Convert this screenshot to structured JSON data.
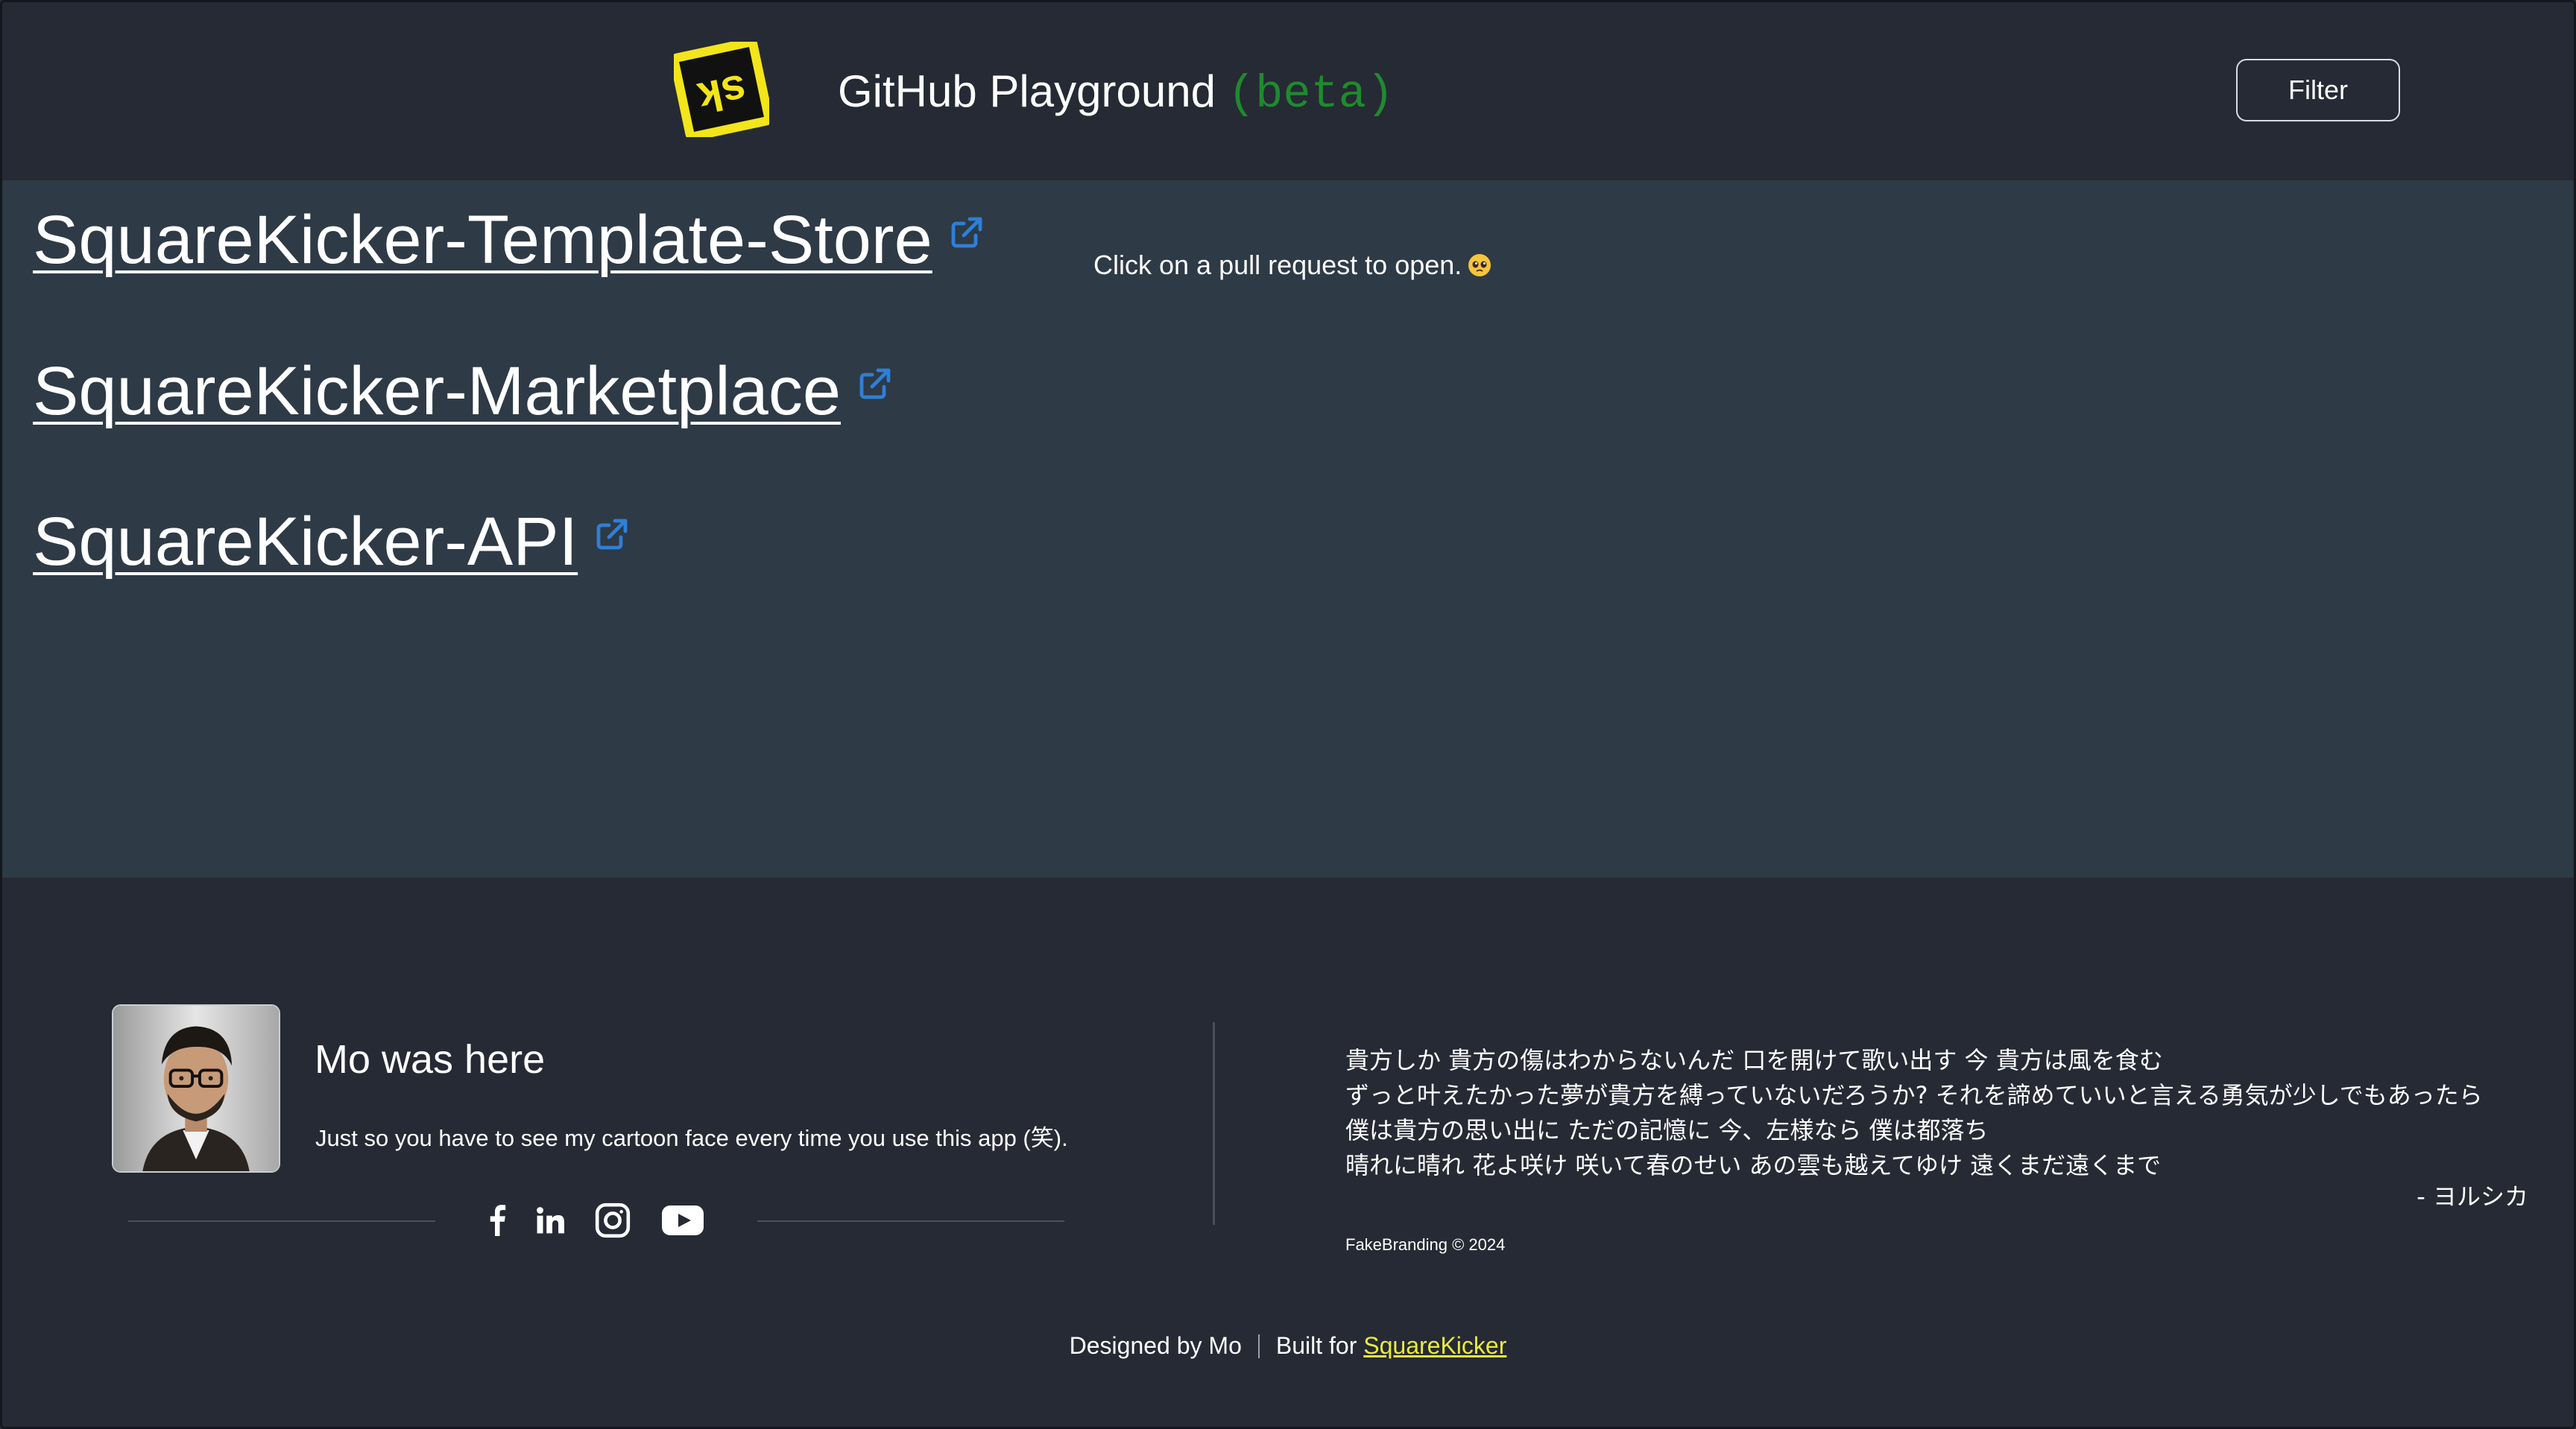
{
  "header": {
    "title": "GitHub Playground",
    "beta": "(beta)",
    "filter_label": "Filter",
    "logo_text": "sk"
  },
  "repos": [
    {
      "name": "SquareKicker-Template-Store"
    },
    {
      "name": "SquareKicker-Marketplace"
    },
    {
      "name": "SquareKicker-API"
    }
  ],
  "hint": "Click on a pull request to open.",
  "footer": {
    "title": "Mo was here",
    "subtitle": "Just so you have to see my cartoon face every time you use this app (笑).",
    "lyrics": [
      "貴方しか 貴方の傷はわからないんだ 口を開けて歌い出す 今 貴方は風を食む",
      "ずっと叶えたかった夢が貴方を縛っていないだろうか? それを諦めていいと言える勇気が少しでもあったら",
      "僕は貴方の思い出に ただの記憶に 今、左様なら 僕は都落ち",
      "晴れに晴れ 花よ咲け 咲いて春のせい あの雲も越えてゆけ 遠くまだ遠くまで"
    ],
    "attribution": "- ヨルシカ",
    "copyright": "FakeBranding © 2024",
    "designed_by": "Designed by Mo",
    "built_for": "Built for",
    "built_for_link": "SquareKicker"
  },
  "colors": {
    "header_bg": "#262a34",
    "main_bg": "#2e3a46",
    "beta": "#1f8a2e",
    "logo_yellow": "#f2e51a",
    "link_icon": "#2f7fd6",
    "sk_link": "#e8ec3c"
  }
}
